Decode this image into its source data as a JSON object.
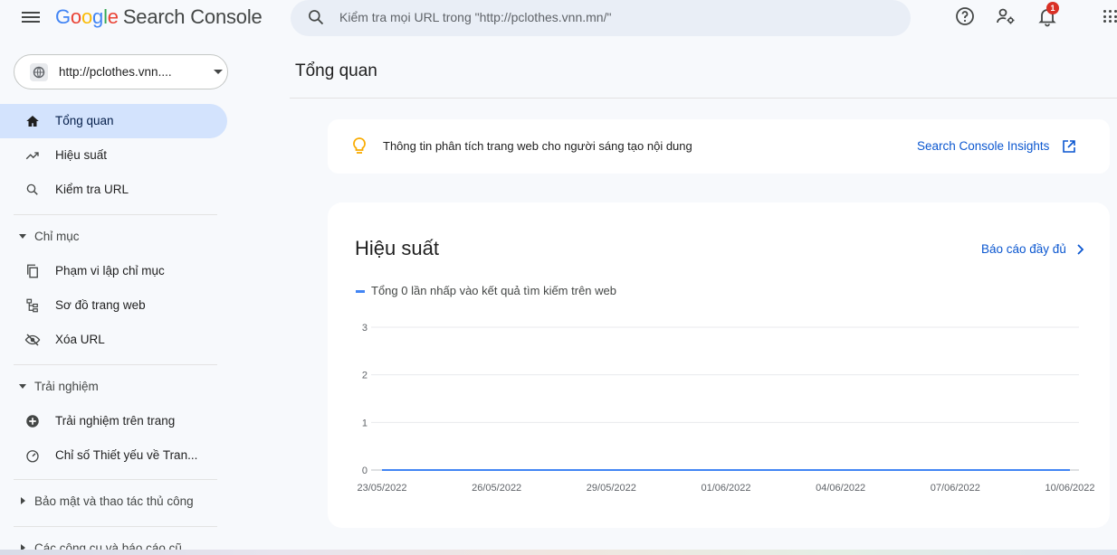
{
  "header": {
    "logo_letters": [
      "G",
      "o",
      "o",
      "g",
      "l",
      "e"
    ],
    "product": "Search Console",
    "search_placeholder": "Kiểm tra mọi URL trong \"http://pclothes.vnn.mn/\"",
    "notification_count": "1",
    "icons": [
      "menu-icon",
      "search-icon",
      "help-icon",
      "settings-users-icon",
      "bell-icon",
      "apps-icon"
    ]
  },
  "sidebar": {
    "property": "http://pclothes.vnn....",
    "items": [
      {
        "label": "Tổng quan",
        "icon": "home-icon",
        "active": true
      },
      {
        "label": "Hiệu suất",
        "icon": "trending-icon"
      },
      {
        "label": "Kiểm tra URL",
        "icon": "search-icon"
      }
    ],
    "sections": [
      {
        "label": "Chỉ mục",
        "expanded": true,
        "items": [
          {
            "label": "Phạm vi lập chỉ mục",
            "icon": "copy-icon"
          },
          {
            "label": "Sơ đồ trang web",
            "icon": "sitemap-icon"
          },
          {
            "label": "Xóa URL",
            "icon": "visibility-off-icon"
          }
        ]
      },
      {
        "label": "Trải nghiệm",
        "expanded": true,
        "items": [
          {
            "label": "Trải nghiệm trên trang",
            "icon": "add-circle-icon"
          },
          {
            "label": "Chỉ số Thiết yếu về Tran...",
            "icon": "speed-icon"
          }
        ]
      },
      {
        "label": "Bảo mật và thao tác thủ công",
        "expanded": false
      },
      {
        "label": "Các công cụ và báo cáo cũ",
        "expanded": false
      }
    ]
  },
  "main": {
    "title": "Tổng quan",
    "insights": {
      "text": "Thông tin phân tích trang web cho người sáng tạo nội dung",
      "link": "Search Console Insights"
    },
    "performance": {
      "title": "Hiệu suất",
      "full_report": "Báo cáo đầy đủ",
      "legend": "Tổng 0 lần nhấp vào kết quả tìm kiếm trên web"
    }
  },
  "colors": {
    "accent": "#0b57d0",
    "series": "#4285f4",
    "active_nav": "#d3e3fd"
  },
  "chart_data": {
    "type": "line",
    "x": [
      "23/05/2022",
      "24/05/2022",
      "25/05/2022",
      "26/05/2022",
      "27/05/2022",
      "28/05/2022",
      "29/05/2022",
      "30/05/2022",
      "31/05/2022",
      "01/06/2022",
      "02/06/2022",
      "03/06/2022",
      "04/06/2022",
      "05/06/2022",
      "06/06/2022",
      "07/06/2022",
      "08/06/2022",
      "09/06/2022",
      "10/06/2022"
    ],
    "tick_labels": [
      "23/05/2022",
      "26/05/2022",
      "29/05/2022",
      "01/06/2022",
      "04/06/2022",
      "07/06/2022",
      "10/06/2022"
    ],
    "series": [
      {
        "name": "Tổng 0 lần nhấp vào kết quả tìm kiếm trên web",
        "values": [
          0,
          0,
          0,
          0,
          0,
          0,
          0,
          0,
          0,
          0,
          0,
          0,
          0,
          0,
          0,
          0,
          0,
          0,
          0
        ]
      }
    ],
    "yticks": [
      0,
      1,
      2,
      3
    ],
    "ylim": [
      0,
      3
    ],
    "grid": true
  }
}
